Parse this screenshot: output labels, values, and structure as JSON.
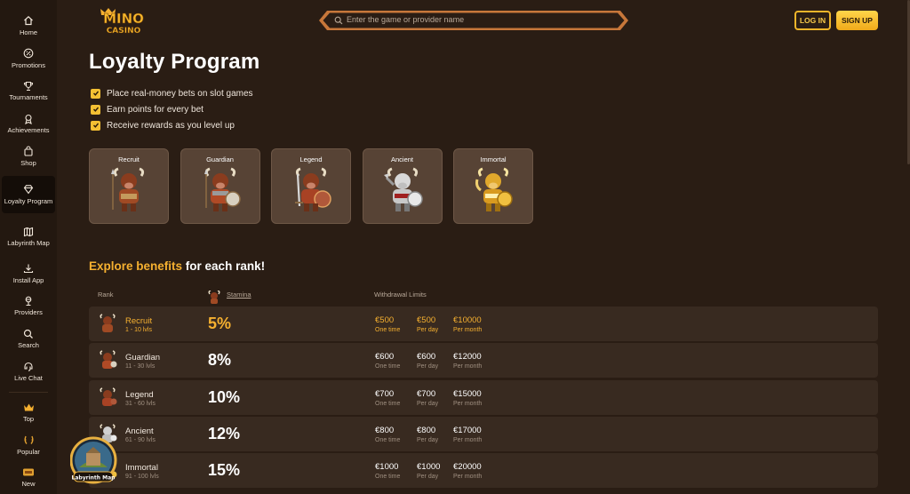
{
  "sidebar": {
    "items": [
      {
        "label": "Home",
        "icon": "home-icon"
      },
      {
        "label": "Promotions",
        "icon": "promotions-icon"
      },
      {
        "label": "Tournaments",
        "icon": "trophy-icon"
      },
      {
        "label": "Achievements",
        "icon": "medal-icon"
      },
      {
        "label": "Shop",
        "icon": "shop-bag-icon"
      },
      {
        "label": "Loyalty Program",
        "icon": "diamond-icon"
      },
      {
        "label": "Labyrinth Map",
        "icon": "map-icon"
      },
      {
        "label": "Install App",
        "icon": "download-icon"
      },
      {
        "label": "Providers",
        "icon": "providers-icon"
      },
      {
        "label": "Search",
        "icon": "search-icon"
      },
      {
        "label": "Live Chat",
        "icon": "chat-icon"
      },
      {
        "label": "Top",
        "icon": "crown-icon"
      },
      {
        "label": "Popular",
        "icon": "laurel-icon"
      },
      {
        "label": "New",
        "icon": "new-icon"
      }
    ]
  },
  "header": {
    "logo_top": "MINO",
    "logo_bottom": "CASINO",
    "search_placeholder": "Enter the game or provider name",
    "login_label": "LOG IN",
    "signup_label": "SIGN UP"
  },
  "page": {
    "title": "Loyalty Program",
    "bullets": [
      "Place real-money bets on slot games",
      "Earn points for every bet",
      "Receive rewards as you level up"
    ],
    "ranks": [
      "Recruit",
      "Guardian",
      "Legend",
      "Ancient",
      "Immortal"
    ],
    "explore_highlight": "Explore benefits",
    "explore_rest": "for each rank!"
  },
  "table": {
    "headers": {
      "rank": "Rank",
      "stamina": "Stamina",
      "withdrawal": "Withdrawal Limits"
    },
    "rows": [
      {
        "name": "Recruit",
        "levels": "1 - 10 lvls",
        "stamina": "5%",
        "day_once": "€500",
        "per_day": "€500",
        "per_month": "€10000"
      },
      {
        "name": "Guardian",
        "levels": "11 - 30 lvls",
        "stamina": "8%",
        "day_once": "€600",
        "per_day": "€600",
        "per_month": "€12000"
      },
      {
        "name": "Legend",
        "levels": "31 - 60 lvls",
        "stamina": "10%",
        "day_once": "€700",
        "per_day": "€700",
        "per_month": "€15000"
      },
      {
        "name": "Ancient",
        "levels": "61 - 90 lvls",
        "stamina": "12%",
        "day_once": "€800",
        "per_day": "€800",
        "per_month": "€17000"
      },
      {
        "name": "Immortal",
        "levels": "91 - 100 lvls",
        "stamina": "15%",
        "day_once": "€1000",
        "per_day": "€1000",
        "per_month": "€20000"
      }
    ],
    "labels": {
      "one_time": "One time",
      "per_day": "Per day",
      "per_month": "Per month"
    }
  },
  "badge": {
    "label": "Labyrinth Map"
  },
  "colors": {
    "accent": "#f5b030",
    "bg": "#2a1d14",
    "card": "#574335",
    "row": "#382a20"
  }
}
